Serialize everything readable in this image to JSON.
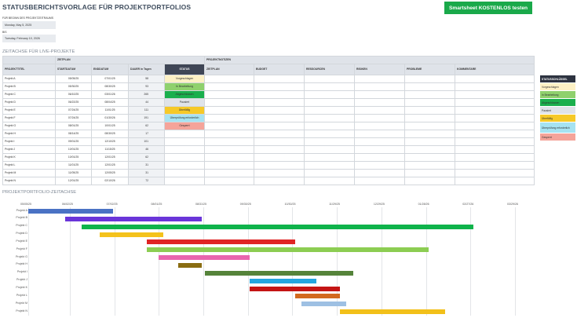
{
  "page": {
    "title": "STATUSBERICHTSVORLAGE FÜR PROJEKTPORTFOLIOS",
    "cta_label": "Smartsheet KOSTENLOS testen",
    "begin_label": "FÜR BEGINN DES PROJEKTZEITRAUMS",
    "start_date": "Monday, May 5, 2025",
    "bis_label": "BIS",
    "end_date": "Tuesday, February 10, 2026",
    "section_timeline": "ZEITACHSE FÜR LIVE-PROJEKTE",
    "section_gantt": "PROJEKTPORTFOLIO-ZEITACHSE"
  },
  "table": {
    "group_headers": {
      "zeitplan": "ZEITPLAN",
      "projektnotizen": "PROJEKTNOTIZEN"
    },
    "columns": [
      "PROJEKTTITEL",
      "STARTDATUM",
      "ENDDATUM",
      "DAUER in Tagen",
      "STATUS",
      "ZEITPLAN",
      "BUDGET",
      "RESSOURCEN",
      "RISIKEN",
      "PROBLEME",
      "KOMMENTARE"
    ],
    "rows": [
      {
        "name": "Projekt A",
        "start": "05/05/25",
        "end": "07/01/25",
        "days": "58",
        "status": "Vorgeschlagen",
        "status_color": "#fdf1c5"
      },
      {
        "name": "Projekt B",
        "start": "05/30/25",
        "end": "08/30/25",
        "days": "93",
        "status": "In Bearbeitung",
        "status_color": "#8fd16d"
      },
      {
        "name": "Projekt C",
        "start": "06/10/25",
        "end": "03/01/26",
        "days": "265",
        "status": "Abgeschlossen",
        "status_color": "#1aaf4d"
      },
      {
        "name": "Projekt D",
        "start": "06/22/25",
        "end": "08/04/25",
        "days": "44",
        "status": "Pausiert",
        "status_color": "#dfe3e9"
      },
      {
        "name": "Projekt E",
        "start": "07/24/25",
        "end": "11/01/25",
        "days": "111",
        "status": "Überfällig",
        "status_color": "#f6c928"
      },
      {
        "name": "Projekt F",
        "start": "07/24/25",
        "end": "01/30/26",
        "days": "191",
        "status": "Überprüfung erforderlich",
        "status_color": "#a6e3f2"
      },
      {
        "name": "Projekt G",
        "start": "08/01/25",
        "end": "10/01/25",
        "days": "62",
        "status": "Gesperrt",
        "status_color": "#f5a49a"
      },
      {
        "name": "Projekt H",
        "start": "08/14/25",
        "end": "08/30/25",
        "days": "17",
        "status": "",
        "status_color": ""
      },
      {
        "name": "Projekt I",
        "start": "09/01/25",
        "end": "12/10/25",
        "days": "101",
        "status": "",
        "status_color": ""
      },
      {
        "name": "Projekt J",
        "start": "10/01/25",
        "end": "11/15/25",
        "days": "46",
        "status": "",
        "status_color": ""
      },
      {
        "name": "Projekt K",
        "start": "10/01/25",
        "end": "12/01/25",
        "days": "62",
        "status": "",
        "status_color": ""
      },
      {
        "name": "Projekt L",
        "start": "11/01/25",
        "end": "12/01/25",
        "days": "31",
        "status": "",
        "status_color": ""
      },
      {
        "name": "Projekt M",
        "start": "11/05/25",
        "end": "12/05/25",
        "days": "31",
        "status": "",
        "status_color": ""
      },
      {
        "name": "Projekt N",
        "start": "12/01/25",
        "end": "02/10/26",
        "days": "72",
        "status": "",
        "status_color": ""
      }
    ]
  },
  "legend": {
    "title": "STATUSSCHLÜSSEL",
    "items": [
      {
        "label": "Vorgeschlagen",
        "color": "#fdf1c5"
      },
      {
        "label": "In Bearbeitung",
        "color": "#8fd16d"
      },
      {
        "label": "Abgeschlossen",
        "color": "#1aaf4d"
      },
      {
        "label": "Pausiert",
        "color": "#dfe3e9"
      },
      {
        "label": "Überfällig",
        "color": "#f6c928"
      },
      {
        "label": "Überprüfung erforderlich",
        "color": "#a6e3f2"
      },
      {
        "label": "Gesperrt",
        "color": "#f5a49a"
      }
    ]
  },
  "chart_data": {
    "type": "bar",
    "orientation": "horizontal-gantt",
    "x_ticks": [
      "05/05/25",
      "06/02/25",
      "07/02/25",
      "08/01/25",
      "08/31/25",
      "09/30/25",
      "10/30/25",
      "11/29/25",
      "12/29/25",
      "01/28/26",
      "02/27/26",
      "03/29/26"
    ],
    "xlim": [
      "05/05/25",
      "03/29/26"
    ],
    "categories": [
      "Projekt A",
      "Projekt B",
      "Projekt C",
      "Projekt D",
      "Projekt E",
      "Projekt F",
      "Projekt G",
      "Projekt H",
      "Projekt I",
      "Projekt J",
      "Projekt K",
      "Projekt L",
      "Projekt M",
      "Projekt N"
    ],
    "series": [
      {
        "start": "05/05/25",
        "end": "07/01/25",
        "color": "#4a72c4"
      },
      {
        "start": "05/30/25",
        "end": "08/30/25",
        "color": "#6a35d9"
      },
      {
        "start": "06/10/25",
        "end": "03/01/26",
        "color": "#0fb34b"
      },
      {
        "start": "06/22/25",
        "end": "08/04/25",
        "color": "#f4c21c"
      },
      {
        "start": "07/24/25",
        "end": "11/01/25",
        "color": "#e02424"
      },
      {
        "start": "07/24/25",
        "end": "01/30/26",
        "color": "#8ccd52"
      },
      {
        "start": "08/01/25",
        "end": "10/01/25",
        "color": "#e866ae"
      },
      {
        "start": "08/14/25",
        "end": "08/30/25",
        "color": "#8a6d12"
      },
      {
        "start": "09/01/25",
        "end": "12/10/25",
        "color": "#55833a"
      },
      {
        "start": "10/01/25",
        "end": "11/15/25",
        "color": "#24a6e0"
      },
      {
        "start": "10/01/25",
        "end": "12/01/25",
        "color": "#c41414"
      },
      {
        "start": "11/01/25",
        "end": "12/01/25",
        "color": "#d2691e"
      },
      {
        "start": "11/05/25",
        "end": "12/05/25",
        "color": "#9ec0e3"
      },
      {
        "start": "12/01/25",
        "end": "02/10/26",
        "color": "#f2c01a"
      }
    ]
  }
}
